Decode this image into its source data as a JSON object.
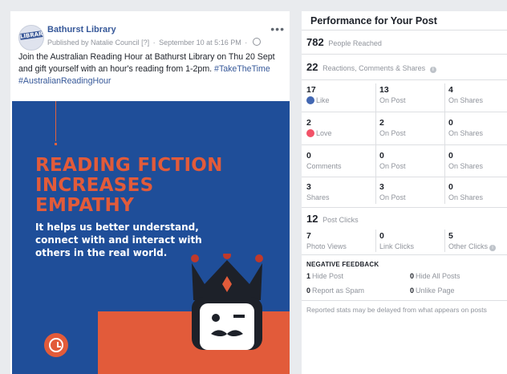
{
  "post": {
    "page_name": "Bathurst Library",
    "avatar_text": "LIBRARY",
    "published_by": "Published by Natalie Council",
    "help_marker": "[?]",
    "date": "September 10 at 5:16 PM",
    "more_icon": "more-icon",
    "text_main": "Join the Australian Reading Hour at Bathurst Library on Thu 20 Sept and gift yourself with an hour's reading from 1-2pm.",
    "hashtag_1": "#TakeTheTime",
    "hashtag_2": "#AustralianReadingHour",
    "image": {
      "headline_1": "READING FICTION",
      "headline_2": "INCREASES",
      "headline_3": "EMPATHY",
      "sub_1": "It helps us better understand,",
      "sub_2": "connect with and interact with",
      "sub_3": "others in the real world.",
      "colors": {
        "background": "#1f4e99",
        "accent": "#e25b3a"
      }
    }
  },
  "panel": {
    "title": "Performance for Your Post",
    "reached": {
      "value": "782",
      "label": "People Reached"
    },
    "engagement": {
      "value": "22",
      "label": "Reactions, Comments & Shares"
    },
    "rows": [
      {
        "total": "17",
        "total_label": "Like",
        "icon": "like-icon",
        "on_post": "13",
        "on_shares": "4"
      },
      {
        "total": "2",
        "total_label": "Love",
        "icon": "love-icon",
        "on_post": "2",
        "on_shares": "0"
      },
      {
        "total": "0",
        "total_label": "Comments",
        "on_post": "0",
        "on_shares": "0"
      },
      {
        "total": "3",
        "total_label": "Shares",
        "on_post": "3",
        "on_shares": "0"
      }
    ],
    "on_post_label": "On Post",
    "on_shares_label": "On Shares",
    "clicks": {
      "value": "12",
      "label": "Post Clicks"
    },
    "click_breakdown": [
      {
        "value": "7",
        "label": "Photo Views"
      },
      {
        "value": "0",
        "label": "Link Clicks"
      },
      {
        "value": "5",
        "label": "Other Clicks"
      }
    ],
    "negative": {
      "title": "NEGATIVE FEEDBACK",
      "hide_post": {
        "value": "1",
        "label": "Hide Post"
      },
      "hide_all": {
        "value": "0",
        "label": "Hide All Posts"
      },
      "report_spam": {
        "value": "0",
        "label": "Report as Spam"
      },
      "unlike_page": {
        "value": "0",
        "label": "Unlike Page"
      }
    },
    "note": "Reported stats may be delayed from what appears on posts",
    "colors": {
      "like": "#4267b2",
      "love": "#f25268",
      "link": "#365899"
    }
  }
}
